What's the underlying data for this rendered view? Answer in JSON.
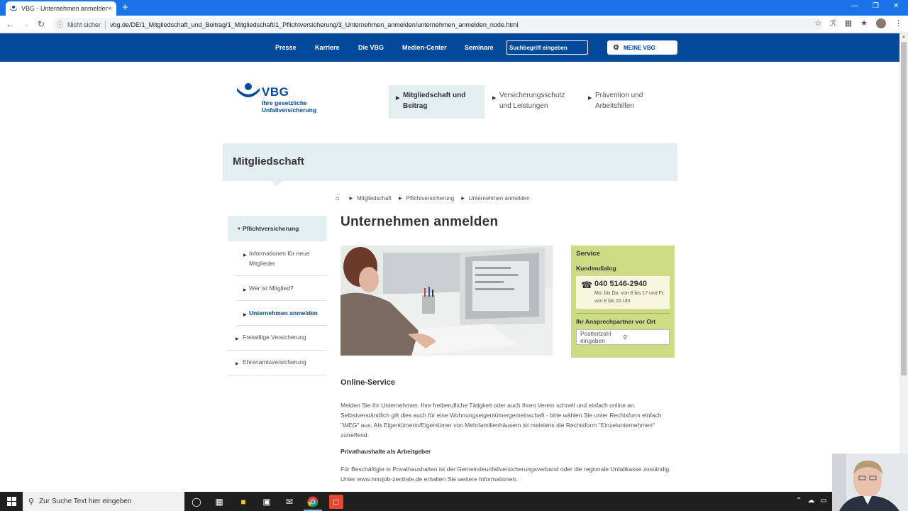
{
  "browser": {
    "tab_title": "VBG - Unternehmen anmelden",
    "tab_close": "×",
    "new_tab": "+",
    "security_label": "Nicht sicher",
    "url": "vbg.de/DE/1_Mitgliedschaft_und_Beitrag/1_Mitgliedschaft/1_Pflichtversicherung/3_Unternehmen_anmelden/unternehmen_anmelden_node.html"
  },
  "topnav": {
    "links": [
      "Presse",
      "Karriere",
      "Die VBG",
      "Medien-Center",
      "Seminare"
    ],
    "search_placeholder": "Suchbegriff eingeben",
    "meine_vbg": "MEINE VBG"
  },
  "logo": {
    "brand": "VBG",
    "tagline": "Ihre gesetzliche Unfallversicherung"
  },
  "mainnav": [
    {
      "label": "Mitgliedschaft und Beitrag",
      "active": true
    },
    {
      "label": "Versicherungsschutz und Leistungen",
      "active": false
    },
    {
      "label": "Prävention und Arbeitshilfen",
      "active": false
    }
  ],
  "section_title": "Mitgliedschaft",
  "breadcrumb": [
    "Mitgliedschaft",
    "Pflichtversicherung",
    "Unternehmen anmelden"
  ],
  "sidenav": {
    "parent": "Pflichtversicherung",
    "children": [
      "Informationen für neue Mitglieder",
      "Wer ist Mitglied?",
      "Unternehmen anmelden"
    ],
    "siblings": [
      "Freiwillige Versicherung",
      "Ehrenamtsversicherung"
    ]
  },
  "page_title": "Unternehmen anmelden",
  "service": {
    "heading": "Service",
    "kundendialog": "Kundendialog",
    "phone": "040 5146-2940",
    "hours": "Mo. bis Do. von 8 bis 17 und Fr. von 8 bis 15 Uhr",
    "ansprechpartner": "Ihr Ansprechpartner vor Ort",
    "plz_placeholder": "Postleitzahl eingeben"
  },
  "content": {
    "online_heading": "Online-Service",
    "para1": "Melden Sie Ihr Unternehmen, Ihre freiberufliche Tätigkeit oder auch Ihren Verein schnell und einfach online an. Selbstverständlich gilt dies auch für eine Wohnungseigentümergemeinschaft - bitte wählen Sie unter Rechtsform einfach \"WEG\" aus. Als Eigentümerin/Eigentümer von Mehrfamilienhäusern ist meistens die Rechtsform \"Einzelunternehmen\" zutreffend.",
    "private_heading": "Privathaushalte als Arbeitgeber",
    "para2": "Für Beschäftigte in Privathaushalten ist der Gemeindeunfallversicherungsverband oder die regionale Unfallkasse zuständig. Unter www.minijob-zentrale.de erhalten Sie weitere Informationen."
  },
  "taskbar": {
    "search_placeholder": "Zur Suche Text hier eingeben"
  },
  "colors": {
    "brand_blue": "#004a99",
    "chrome_blue": "#1a73e8",
    "light_band": "#e3eef1",
    "service_green": "#cddc84"
  }
}
